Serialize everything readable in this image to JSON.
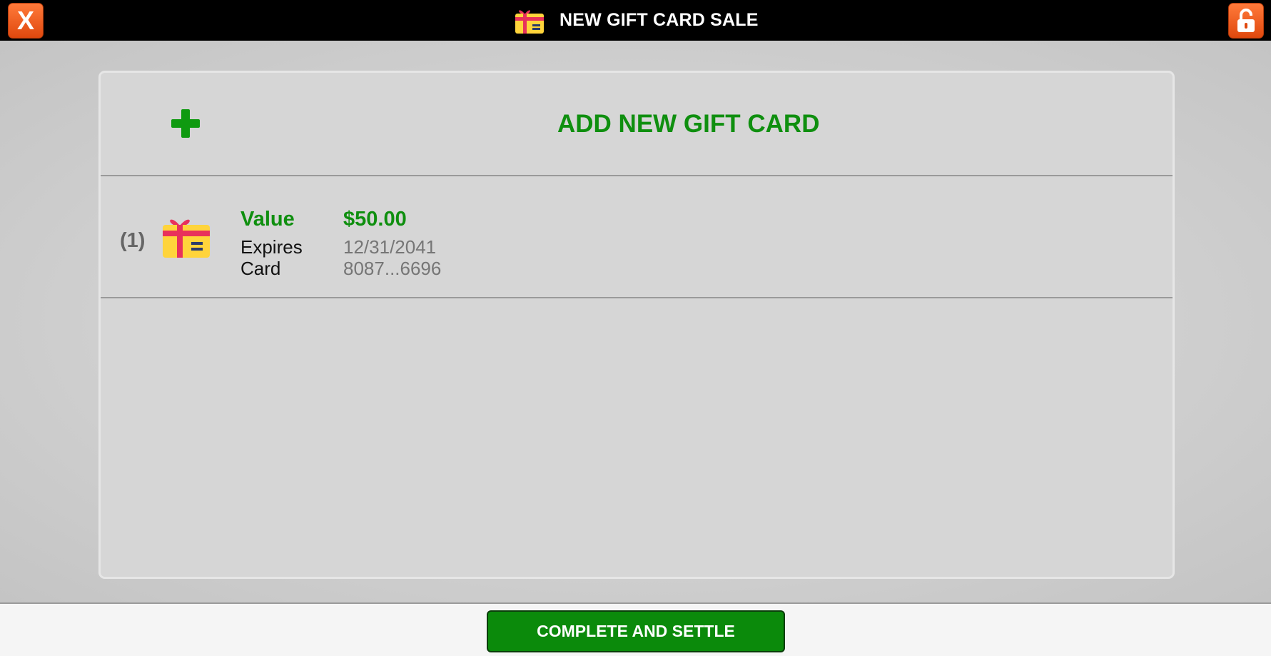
{
  "header": {
    "title": "NEW GIFT CARD SALE",
    "close_icon": "close-x-icon",
    "lock_icon": "unlock-icon",
    "title_icon": "gift-card-icon"
  },
  "add_row": {
    "label": "ADD NEW GIFT CARD",
    "icon": "plus-icon"
  },
  "cards": [
    {
      "index": "(1)",
      "icon": "gift-card-icon",
      "value_label": "Value",
      "value": "$50.00",
      "expires_label": "Expires",
      "expires": "12/31/2041",
      "card_label": "Card",
      "card": "8087...6696"
    }
  ],
  "footer": {
    "settle_label": "COMPLETE AND SETTLE"
  },
  "colors": {
    "accent_green": "#0f8f0f",
    "button_green": "#0b8a0b",
    "header_orange": "#f26522",
    "topbar": "#000000"
  }
}
